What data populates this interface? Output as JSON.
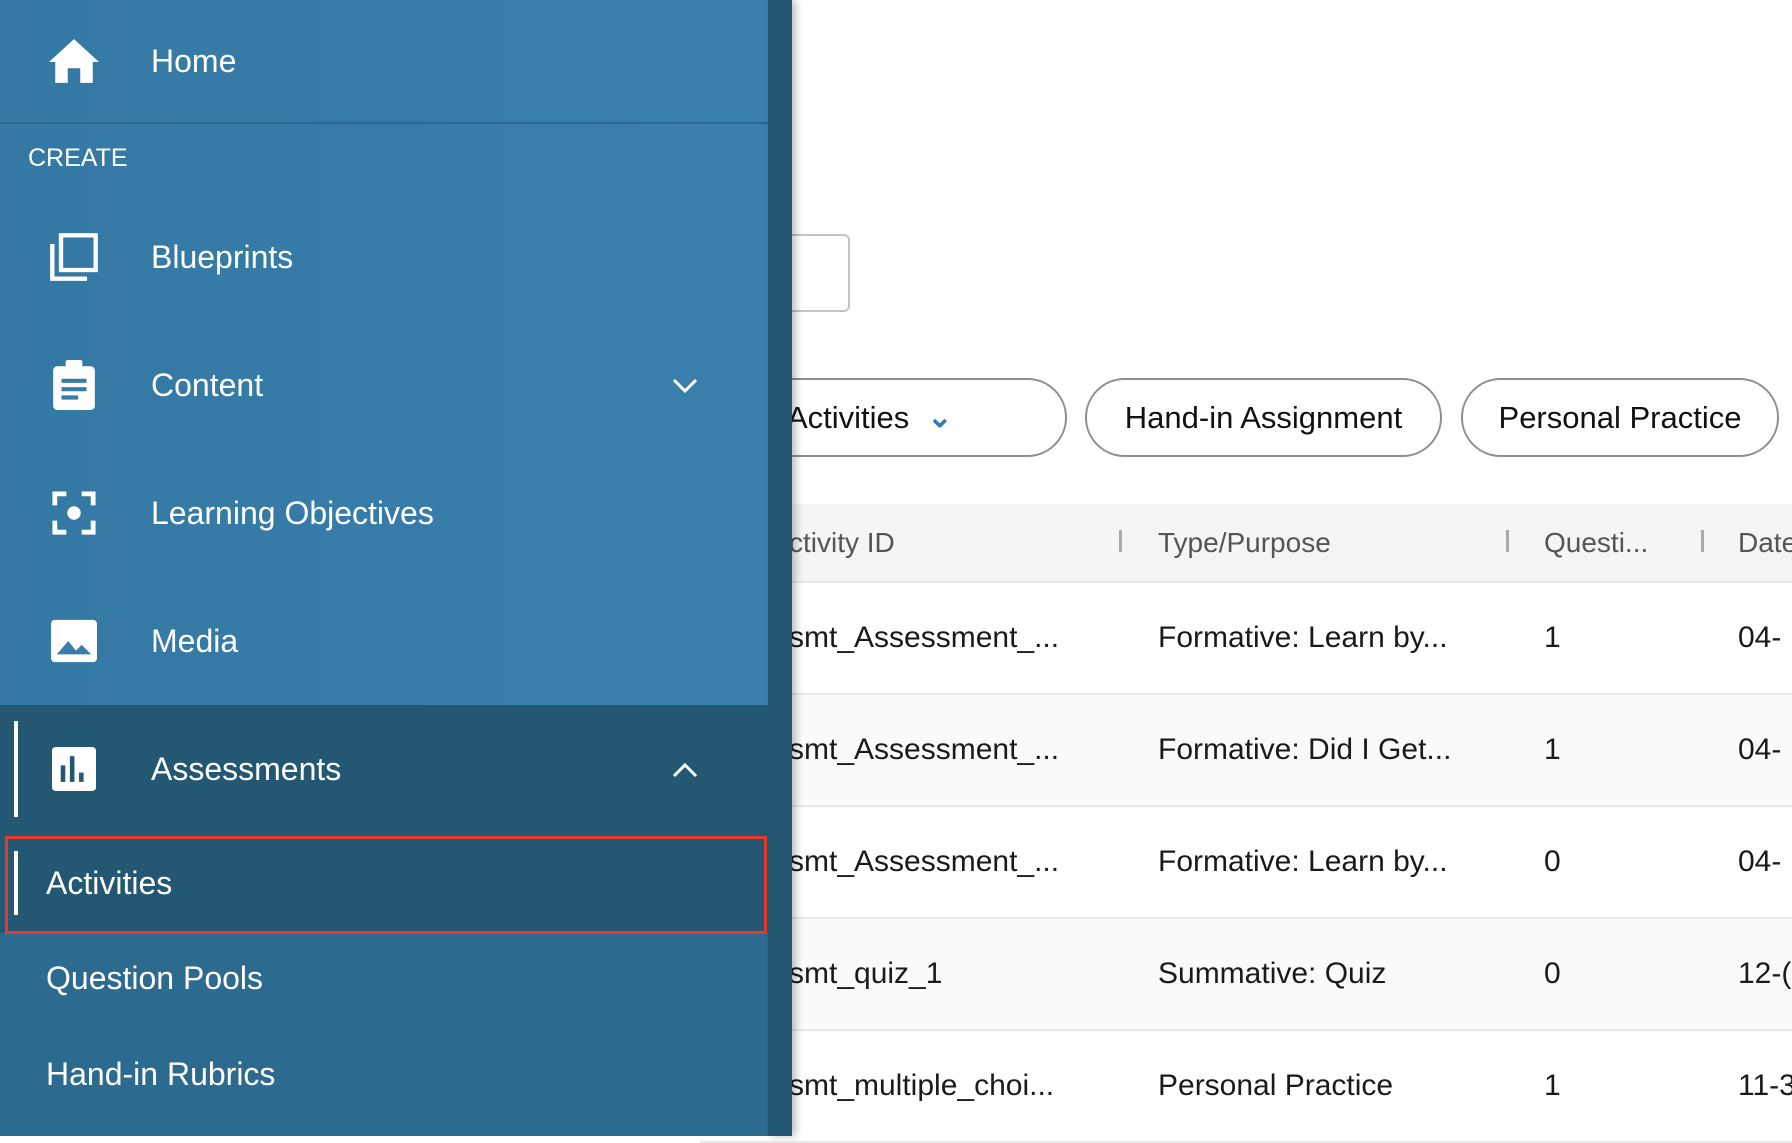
{
  "sidebar": {
    "home": {
      "label": "Home",
      "icon": "home-icon"
    },
    "section_label": "CREATE",
    "items": [
      {
        "label": "Blueprints",
        "icon": "blueprints-icon"
      },
      {
        "label": "Content",
        "icon": "clipboard-icon",
        "expand": "chevron-down-icon"
      },
      {
        "label": "Learning Objectives",
        "icon": "focus-target-icon"
      },
      {
        "label": "Media",
        "icon": "image-icon"
      },
      {
        "label": "Assessments",
        "icon": "bar-chart-icon",
        "expand": "chevron-up-icon",
        "expanded": true
      }
    ],
    "sub_items": [
      {
        "label": "Activities",
        "selected": true
      },
      {
        "label": "Question Pools"
      },
      {
        "label": "Hand-in Rubrics"
      }
    ]
  },
  "main": {
    "filters": [
      {
        "label": "ative Activities",
        "icon": "chevron-down-icon"
      },
      {
        "label": "Hand-in Assignment"
      },
      {
        "label": "Personal Practice"
      }
    ],
    "table": {
      "columns": [
        "ctivity ID",
        "Type/Purpose",
        "Questi...",
        "Date"
      ],
      "rows": [
        [
          "smt_Assessment_...",
          "Formative: Learn by...",
          "1",
          "04-"
        ],
        [
          "smt_Assessment_...",
          "Formative: Did I Get...",
          "1",
          "04-"
        ],
        [
          "smt_Assessment_...",
          "Formative: Learn by...",
          "0",
          "04-"
        ],
        [
          "smt_quiz_1",
          "Summative: Quiz",
          "0",
          "12-("
        ],
        [
          "smt_multiple_choi...",
          "Personal Practice",
          "1",
          "11-3"
        ]
      ]
    }
  },
  "colors": {
    "sidebar": "#3a7ca8",
    "sidebar_active": "#245872",
    "highlight_box": "#e53a2a",
    "accent": "#2f7bb0"
  }
}
